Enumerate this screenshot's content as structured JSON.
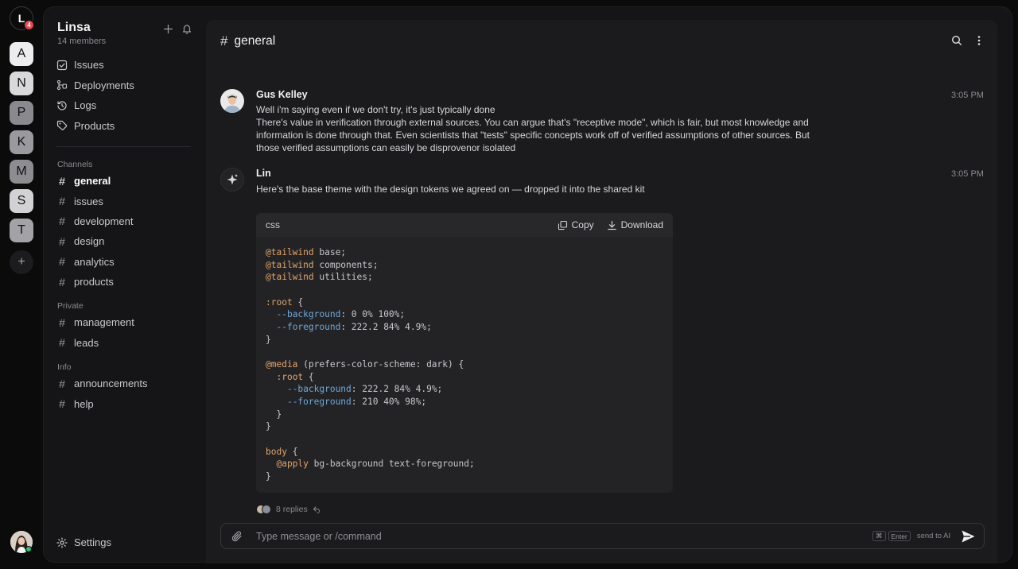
{
  "rail": {
    "current_initial": "L",
    "notification_count": "4",
    "workspaces": [
      {
        "initial": "A",
        "color": "#ececee"
      },
      {
        "initial": "N",
        "color": "#d9d9dc"
      },
      {
        "initial": "P",
        "color": "#8a8a8e"
      },
      {
        "initial": "K",
        "color": "#9a9a9e"
      },
      {
        "initial": "M",
        "color": "#8d8d91"
      },
      {
        "initial": "S",
        "color": "#d2d2d5"
      },
      {
        "initial": "T",
        "color": "#a3a3a7"
      }
    ],
    "add_label": "+"
  },
  "org": {
    "name": "Linsa",
    "members": "14 members"
  },
  "nav": [
    {
      "label": "Issues",
      "icon": "issues-icon"
    },
    {
      "label": "Deployments",
      "icon": "deployments-icon"
    },
    {
      "label": "Logs",
      "icon": "logs-icon"
    },
    {
      "label": "Products",
      "icon": "products-icon"
    }
  ],
  "sections": {
    "channels": {
      "label": "Channels",
      "items": [
        "general",
        "issues",
        "development",
        "design",
        "analytics",
        "products"
      ]
    },
    "private": {
      "label": "Private",
      "items": [
        "management",
        "leads"
      ]
    },
    "info": {
      "label": "Info",
      "items": [
        "announcements",
        "help"
      ]
    }
  },
  "settings_label": "Settings",
  "channel": {
    "title": "general"
  },
  "messages": [
    {
      "author": "Gus Kelley",
      "time": "3:05 PM",
      "line1": "Well i'm saying even if we don't try, it's just typically done",
      "body": "There's value in verification through external sources. You can argue that's \"receptive mode\", which is fair, but most knowledge and information is done through that. Even scientists that \"tests\" specific concepts work off of verified assumptions of other sources. But those verified assumptions can easily be disprovenor isolated"
    },
    {
      "author": "Lin",
      "time": "3:05 PM",
      "text": "Here's the base theme with the design tokens we agreed on — dropped it into the shared kit"
    }
  ],
  "code": {
    "language": "css",
    "copy_label": "Copy",
    "download_label": "Download",
    "lines": [
      [
        [
          "at",
          "@tailwind"
        ],
        [
          "",
          " base;"
        ]
      ],
      [
        [
          "at",
          "@tailwind"
        ],
        [
          "",
          " components;"
        ]
      ],
      [
        [
          "at",
          "@tailwind"
        ],
        [
          "",
          " utilities;"
        ]
      ],
      [],
      [
        [
          "sel",
          ":root"
        ],
        [
          "",
          " {"
        ]
      ],
      [
        [
          "",
          "  "
        ],
        [
          "var",
          "--background"
        ],
        [
          "",
          ": 0 0% 100%;"
        ]
      ],
      [
        [
          "",
          "  "
        ],
        [
          "var",
          "--foreground"
        ],
        [
          "",
          ": 222.2 84% 4.9%;"
        ]
      ],
      [
        [
          "",
          "}"
        ]
      ],
      [],
      [
        [
          "at",
          "@media"
        ],
        [
          "",
          " (prefers-color-scheme: dark) {"
        ]
      ],
      [
        [
          "",
          "  "
        ],
        [
          "sel",
          ":root"
        ],
        [
          "",
          " {"
        ]
      ],
      [
        [
          "",
          "    "
        ],
        [
          "var",
          "--background"
        ],
        [
          "",
          ": 222.2 84% 4.9%;"
        ]
      ],
      [
        [
          "",
          "    "
        ],
        [
          "var",
          "--foreground"
        ],
        [
          "",
          ": 210 40% 98%;"
        ]
      ],
      [
        [
          "",
          "  }"
        ]
      ],
      [
        [
          "",
          "}"
        ]
      ],
      [],
      [
        [
          "sel",
          "body"
        ],
        [
          "",
          " {"
        ]
      ],
      [
        [
          "",
          "  "
        ],
        [
          "at",
          "@apply"
        ],
        [
          "",
          " bg-background text-foreground;"
        ]
      ],
      [
        [
          "",
          "}"
        ]
      ]
    ]
  },
  "replies": {
    "label": "8 replies"
  },
  "composer": {
    "placeholder": "Type message or /command",
    "value": "",
    "kbd_cmd": "⌘",
    "kbd_enter": "Enter",
    "hint": "send to AI"
  }
}
